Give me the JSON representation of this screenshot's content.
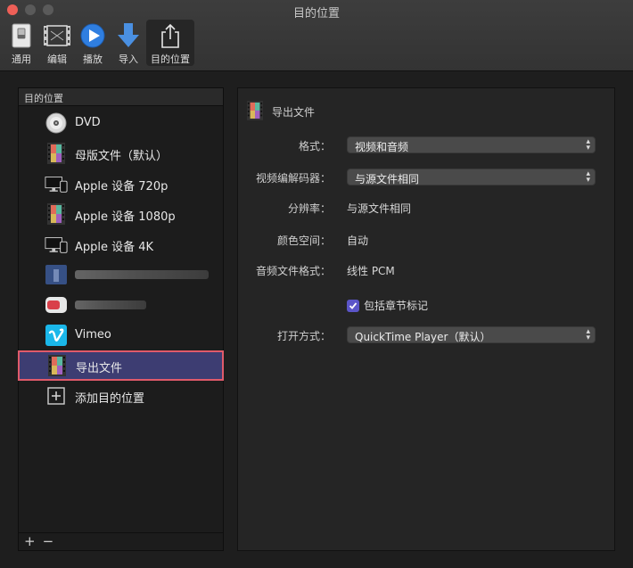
{
  "window": {
    "title": "目的位置"
  },
  "toolbar": {
    "items": [
      {
        "label": "通用",
        "icon": "switch-icon"
      },
      {
        "label": "编辑",
        "icon": "film-strip-icon"
      },
      {
        "label": "播放",
        "icon": "play-icon"
      },
      {
        "label": "导入",
        "icon": "download-arrow-icon"
      },
      {
        "label": "目的位置",
        "icon": "share-icon",
        "active": true
      }
    ]
  },
  "sidebar": {
    "header": "目的位置",
    "items": [
      {
        "label": "DVD",
        "icon": "dvd-disc-icon"
      },
      {
        "label": "母版文件（默认）",
        "icon": "film-file-icon"
      },
      {
        "label": "Apple 设备 720p",
        "icon": "apple-devices-icon"
      },
      {
        "label": "Apple 设备 1080p",
        "icon": "film-file-icon"
      },
      {
        "label": "Apple 设备 4K",
        "icon": "apple-devices-icon"
      },
      {
        "label": "",
        "icon": "facebook-icon",
        "blurred": true
      },
      {
        "label": "",
        "icon": "youtube-icon",
        "blurred": true
      },
      {
        "label": "Vimeo",
        "icon": "vimeo-icon"
      },
      {
        "label": "导出文件",
        "icon": "film-file-icon",
        "selected": true
      },
      {
        "label": "添加目的位置",
        "icon": "add-box-icon"
      }
    ],
    "footer": {
      "add": "+",
      "remove": "−"
    }
  },
  "detail": {
    "title": "导出文件",
    "format_label": "格式：",
    "format_value": "视频和音频",
    "codec_label": "视频编解码器：",
    "codec_value": "与源文件相同",
    "resolution_label": "分辨率：",
    "resolution_value": "与源文件相同",
    "colorspace_label": "颜色空间：",
    "colorspace_value": "自动",
    "audio_format_label": "音频文件格式：",
    "audio_format_value": "线性 PCM",
    "chapter_markers_label": "包括章节标记",
    "chapter_markers_checked": true,
    "open_with_label": "打开方式：",
    "open_with_value": "QuickTime Player（默认）"
  },
  "colors": {
    "selection_bg": "#3d3d72",
    "selection_border": "#e05a6a",
    "checkbox_accent": "#5b55c8",
    "close_button": "#ee5f57"
  }
}
